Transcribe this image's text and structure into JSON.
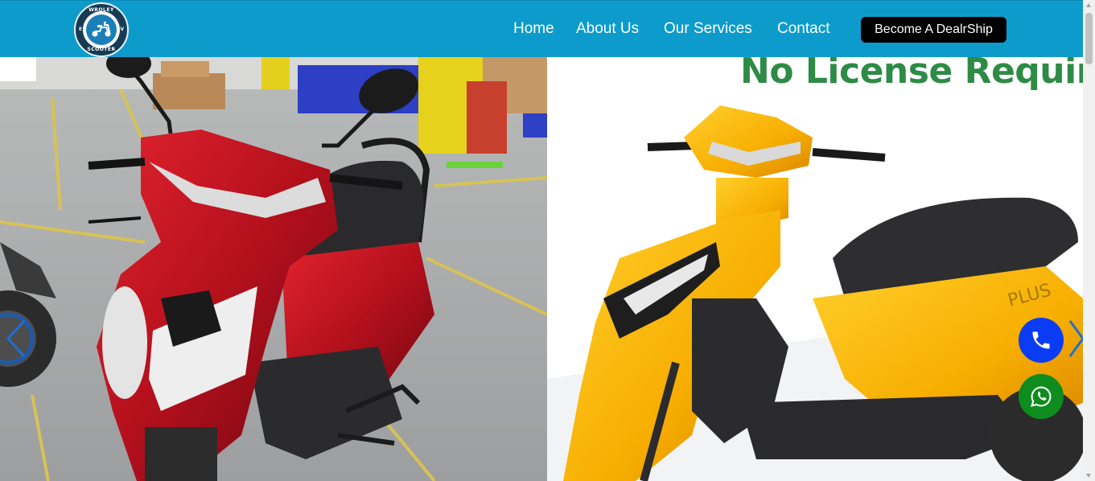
{
  "brand": {
    "logo_top": "WROLEY",
    "logo_bottom": "SCOOTER",
    "logo_left": "E",
    "logo_right": "V"
  },
  "nav": {
    "items": [
      {
        "label": "Home"
      },
      {
        "label": "About Us"
      },
      {
        "label": "Our Services"
      },
      {
        "label": "Contact"
      }
    ],
    "cta_label": "Become A DealrShip"
  },
  "hero": {
    "headline": "No License Required."
  },
  "colors": {
    "nav_bg": "#0d9bcb",
    "cta_bg": "#000000",
    "call_button": "#0a3cf4",
    "whatsapp_button": "#0e8c1e",
    "headline": "#2e8b45",
    "arrow": "#1f6fd1"
  },
  "icons": {
    "call": "phone-icon",
    "whatsapp": "whatsapp-icon",
    "prev": "chevron-left-icon",
    "next": "chevron-right-icon"
  }
}
